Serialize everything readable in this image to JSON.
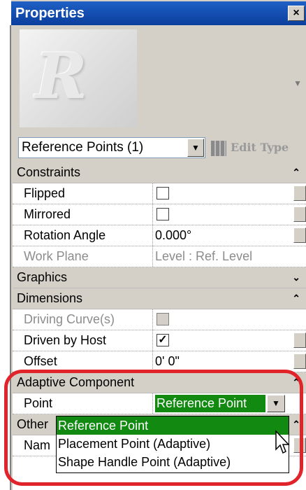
{
  "window": {
    "title": "Properties",
    "close_glyph": "×",
    "close_icon": "close-icon"
  },
  "preview": {
    "thumbnail_glyph": "R",
    "expand_glyph": "▼"
  },
  "type_selector": {
    "value": "Reference Points (1)",
    "arrow_glyph": "▼",
    "edit_type_label": "Edit Type"
  },
  "groups": {
    "constraints": {
      "label": "Constraints",
      "chevron": "⌃"
    },
    "graphics": {
      "label": "Graphics",
      "chevron": "⌄"
    },
    "dimensions": {
      "label": "Dimensions",
      "chevron": "⌃"
    },
    "adaptive": {
      "label": "Adaptive Component",
      "chevron": "⌃"
    },
    "other": {
      "label": "Other",
      "chevron": "⌃"
    }
  },
  "properties": {
    "flipped": {
      "label": "Flipped",
      "checked": ""
    },
    "mirrored": {
      "label": "Mirrored",
      "checked": ""
    },
    "rotation_angle": {
      "label": "Rotation Angle",
      "value": "0.000°"
    },
    "work_plane": {
      "label": "Work Plane",
      "value": "Level : Ref. Level"
    },
    "driving_curves": {
      "label": "Driving Curve(s)",
      "checked": ""
    },
    "driven_by_host": {
      "label": "Driven by Host",
      "checked": "✓"
    },
    "offset": {
      "label": "Offset",
      "value": "0'  0\""
    },
    "point": {
      "label": "Point",
      "value": "Reference Point",
      "arrow_glyph": "▼"
    },
    "name": {
      "label": "Nam"
    }
  },
  "dropdown": {
    "options": [
      {
        "label": "Reference Point",
        "selected": true
      },
      {
        "label": "Placement Point (Adaptive)",
        "selected": false
      },
      {
        "label": "Shape Handle Point (Adaptive)",
        "selected": false
      }
    ]
  },
  "colors": {
    "title_bar": "#1f5fc4",
    "selection_green": "#128a12",
    "highlight_red": "#e0242a",
    "chrome": "#d4d0c8"
  }
}
